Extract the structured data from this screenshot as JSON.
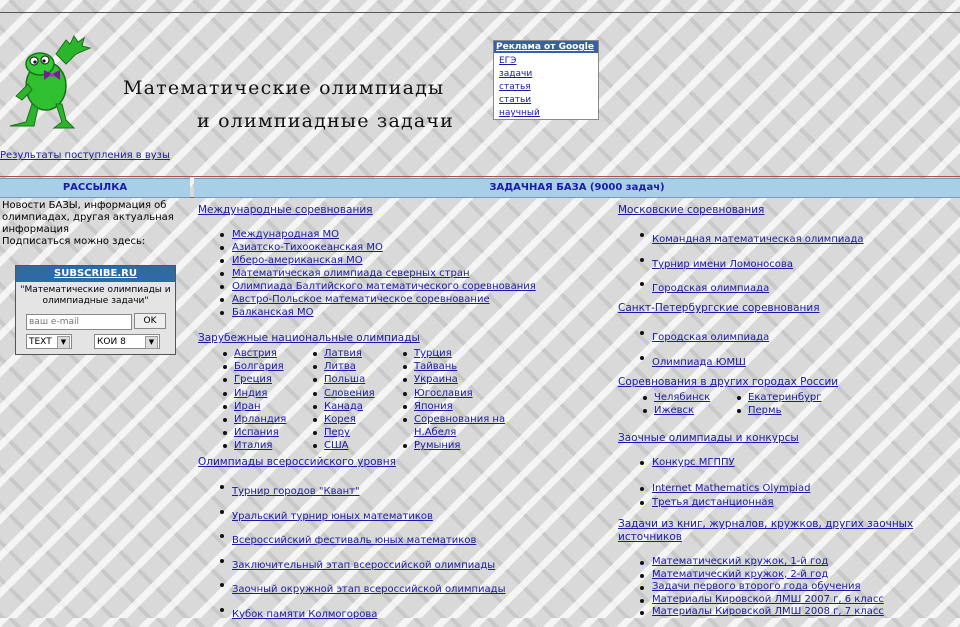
{
  "header": {
    "title_line1": "Математические олимпиады",
    "title_line2": "и олимпиадные задачи"
  },
  "google_box": {
    "title": "Реклама от Google",
    "links": [
      "ЕГЭ",
      "задачи",
      "статья",
      "статьи",
      "научный"
    ]
  },
  "results_link": "Результаты поступления в вузы",
  "left": {
    "header": "РАССЫЛКА",
    "text": "Новости БАЗЫ, информация об олимпиадах, другая актуальная информация",
    "subscribe_prompt": "Подписаться можно здесь:",
    "subscribe": {
      "title": "SUBSCRIBE.RU",
      "text": "\"Математические олимпиады и олимпиадные задачи\"",
      "email_placeholder": "ваш e-mail",
      "ok_label": "OK",
      "format_value": "TEXT",
      "encoding_value": "КОИ 8"
    }
  },
  "main": {
    "header": "ЗАДАЧНАЯ БАЗА (9000 задач)",
    "left_col": {
      "intl_title": "Международные соревнования",
      "intl_items": [
        "Международная МО",
        "Азиатско-Тихоокеанская МО",
        "Иберо-американская МО",
        "Математическая олимпиада северных стран",
        "Олимпиада Балтийского математического соревнования",
        "Австро-Польское математическое соревнование",
        "Балканская МО"
      ],
      "foreign_title": "Зарубежные национальные олимпиады",
      "foreign_col1": [
        "Австрия",
        "Болгария",
        "Греция",
        "Индия",
        "Иран",
        "Ирландия",
        "Испания",
        "Италия"
      ],
      "foreign_col2": [
        "Латвия",
        "Литва",
        "Польша",
        "Словения",
        "Канада",
        "Корея",
        "Перу",
        "США"
      ],
      "foreign_col3": [
        "Турция",
        "Тайвань",
        "Украина",
        "Югославия",
        "Япония",
        "Соревнования на",
        "Н.Абеля",
        "Румыния"
      ],
      "allrus_title": "Олимпиады всероссийского уровня",
      "allrus_items": [
        "Турнир городов \"Квант\"",
        "Уральский турнир юных математиков",
        "Всероссийский фестиваль юных математиков",
        "Заключительный этап всероссийской олимпиады",
        "Заочный окружной этап всероссийской олимпиады",
        "Кубок памяти Колмогорова"
      ]
    },
    "right_col": {
      "moscow_title": "Московские соревнования",
      "moscow_items": [
        "Командная математическая олимпиада",
        "Турнир имени Ломоносова",
        "Городская олимпиада"
      ],
      "spb_title": "Санкт-Петербургские соревнования",
      "spb_items": [
        "Городская олимпиада",
        "Олимпиада ЮМШ"
      ],
      "other_title": "Соревнования в других городах России",
      "other_col1": [
        "Челябинск",
        "Ижевск"
      ],
      "other_col2": [
        "Екатеринбург",
        "Пермь"
      ],
      "distance_title": "Заочные олимпиады и конкурсы",
      "distance_items": [
        "Конкурс МГППУ",
        "Internet Mathematics Olympiad",
        "Третья дистанционная"
      ],
      "tasks_title": "Задачи из книг, журналов, кружков, других заочных источников",
      "tasks_items": [
        "Математический кружок, 1-й год",
        "Математический кружок, 2-й год",
        "Задачи первого второго года обучения",
        "Материалы Кировской ЛМШ 2007 г, 6 класс",
        "Материалы Кировской ЛМШ 2008 г, 7 класс"
      ]
    }
  }
}
